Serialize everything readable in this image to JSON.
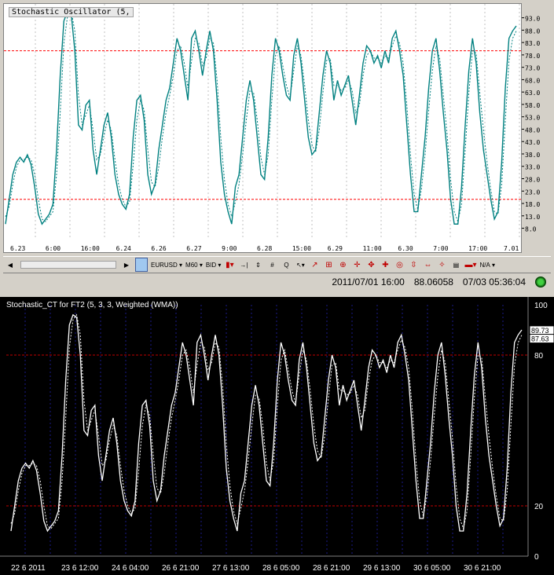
{
  "top_chart": {
    "title": "Stochastic Oscillator (5,",
    "y_ticks": [
      "93.0",
      "88.0",
      "83.0",
      "78.0",
      "73.0",
      "68.0",
      "63.0",
      "58.0",
      "53.0",
      "48.0",
      "43.0",
      "38.0",
      "33.0",
      "28.0",
      "23.0",
      "18.0",
      "13.0",
      "8.0"
    ],
    "x_ticks": [
      "6.23",
      "6:00",
      "16:00",
      "6.24",
      "6.26",
      "6.27",
      "9:00",
      "6.28",
      "15:00",
      "6.29",
      "11:00",
      "6.30",
      "7:00",
      "17:00",
      "7.01"
    ],
    "levels": [
      80,
      20
    ],
    "colors": {
      "line": "#008080",
      "level": "#ff0000",
      "grid": "#c0c0c0"
    }
  },
  "toolbar": {
    "symbol": "EURUSD",
    "timeframe": "M60",
    "price_type": "BID",
    "zoom_label": "N/A"
  },
  "status": {
    "datetime": "2011/07/01 16:00",
    "value": "88.06058",
    "clock": "07/03 05:36:04"
  },
  "bottom_chart": {
    "title": "Stochastic_CT for FT2 (5, 3, 3, Weighted (WMA))",
    "y_ticks": [
      "100",
      "80",
      "20",
      "0"
    ],
    "value_labels": [
      "89.73",
      "87.63"
    ],
    "x_ticks": [
      "22 6 2011",
      "23 6 12:00",
      "24 6 04:00",
      "26 6 21:00",
      "27 6 13:00",
      "28 6 05:00",
      "28 6 21:00",
      "29 6 13:00",
      "30 6 05:00",
      "30 6 21:00"
    ],
    "colors": {
      "line": "#ffffff",
      "level": "#c00000",
      "grid": "#1a1a8a"
    }
  },
  "chart_data": {
    "type": "line",
    "title": "Stochastic Oscillator (5,",
    "ylim": [
      5,
      97
    ],
    "levels": [
      80,
      20
    ],
    "series": [
      {
        "values": [
          10,
          20,
          30,
          35,
          37,
          35,
          38,
          34,
          25,
          14,
          10,
          12,
          14,
          18,
          40,
          70,
          92,
          96,
          95,
          80,
          50,
          48,
          58,
          60,
          40,
          30,
          40,
          50,
          55,
          45,
          30,
          22,
          18,
          16,
          22,
          45,
          60,
          62,
          52,
          30,
          22,
          26,
          40,
          50,
          60,
          65,
          75,
          85,
          80,
          70,
          60,
          85,
          88,
          80,
          70,
          80,
          88,
          80,
          60,
          35,
          22,
          15,
          10,
          25,
          30,
          45,
          60,
          68,
          60,
          45,
          30,
          28,
          45,
          70,
          85,
          80,
          70,
          62,
          60,
          78,
          85,
          75,
          60,
          45,
          38,
          40,
          55,
          70,
          80,
          75,
          60,
          68,
          62,
          66,
          70,
          60,
          50,
          62,
          75,
          82,
          80,
          75,
          78,
          73,
          80,
          75,
          85,
          88,
          80,
          70,
          50,
          30,
          15,
          15,
          30,
          45,
          65,
          80,
          85,
          72,
          55,
          40,
          20,
          10,
          10,
          25,
          50,
          72,
          85,
          75,
          55,
          40,
          30,
          20,
          12,
          15,
          35,
          65,
          85,
          88,
          90
        ]
      },
      {
        "values": [
          13,
          17,
          26,
          33,
          36,
          36,
          37,
          36,
          30,
          20,
          12,
          11,
          13,
          15,
          30,
          55,
          83,
          94,
          96,
          88,
          62,
          50,
          54,
          58,
          48,
          36,
          38,
          46,
          52,
          48,
          36,
          26,
          20,
          17,
          19,
          34,
          52,
          60,
          56,
          40,
          27,
          25,
          33,
          45,
          55,
          62,
          70,
          80,
          82,
          75,
          65,
          76,
          85,
          83,
          74,
          77,
          85,
          83,
          68,
          45,
          28,
          18,
          13,
          19,
          26,
          38,
          52,
          64,
          63,
          52,
          37,
          30,
          38,
          60,
          78,
          82,
          74,
          66,
          61,
          72,
          82,
          78,
          66,
          52,
          42,
          39,
          48,
          63,
          76,
          77,
          66,
          66,
          64,
          65,
          68,
          64,
          55,
          58,
          70,
          78,
          80,
          77,
          77,
          75,
          78,
          77,
          82,
          86,
          83,
          75,
          58,
          38,
          22,
          16,
          24,
          38,
          56,
          72,
          82,
          77,
          62,
          47,
          28,
          15,
          11,
          18,
          40,
          63,
          80,
          79,
          63,
          48,
          35,
          24,
          15,
          14,
          26,
          52,
          76,
          85,
          88
        ]
      }
    ]
  }
}
